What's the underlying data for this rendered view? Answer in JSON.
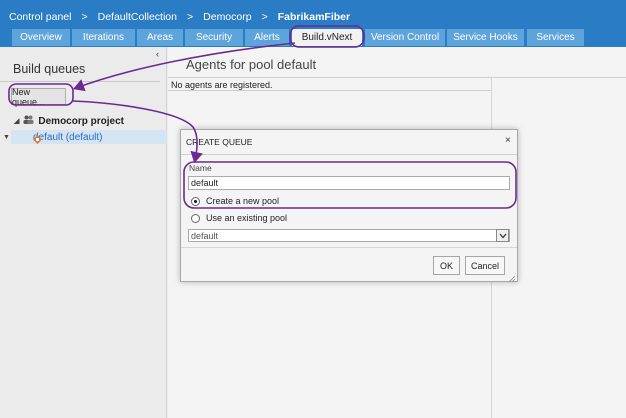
{
  "breadcrumb": {
    "items": [
      "Control panel",
      "DefaultCollection",
      "Democorp"
    ],
    "current": "FabrikamFiber",
    "separator": ">"
  },
  "tabs": [
    "Overview",
    "Iterations",
    "Areas",
    "Security",
    "Alerts",
    "Build.vNext",
    "Version Control",
    "Service Hooks",
    "Services"
  ],
  "active_tab": "Build.vNext",
  "left_pane": {
    "title": "Build queues",
    "collapse_glyph": "‹",
    "new_queue_label": "New queue...",
    "project_label": "Democorp project",
    "queue_item_label": "default (default)"
  },
  "main": {
    "title": "Agents for pool default",
    "empty_message": "No agents are registered."
  },
  "dialog": {
    "title": "CREATE QUEUE",
    "close_glyph": "×",
    "name_label": "Name",
    "name_value": "default",
    "option_new_pool": "Create a new pool",
    "option_existing_pool": "Use an existing pool",
    "selected_option": "new",
    "pool_select_value": "default",
    "ok_label": "OK",
    "cancel_label": "Cancel"
  },
  "colors": {
    "header_blue": "#2a7dc4",
    "tab_blue": "#5da3dc",
    "annotation_purple": "#6a2a8f",
    "link_blue": "#2a6ebb"
  },
  "icons": [
    "people-group-icon",
    "queue-icon",
    "close-icon",
    "chevron-down-icon",
    "resize-grip-icon"
  ]
}
